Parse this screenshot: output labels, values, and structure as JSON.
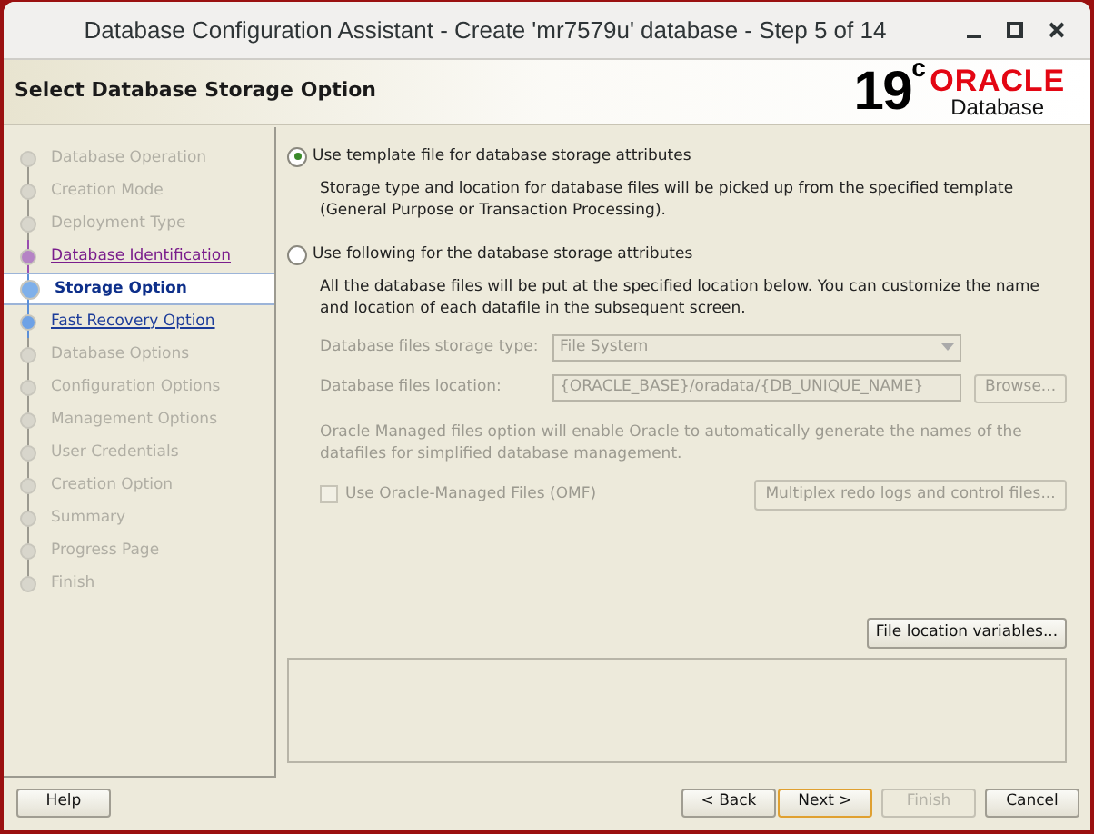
{
  "window": {
    "title": "Database Configuration Assistant - Create 'mr7579u' database  - Step 5 of 14"
  },
  "header": {
    "title": "Select Database Storage Option",
    "logo_version": "19",
    "logo_sup": "c",
    "logo_brand": "ORACLE",
    "logo_product": "Database"
  },
  "steps": [
    {
      "label": "Database Operation",
      "kind": "inactive",
      "selected": false
    },
    {
      "label": "Creation Mode",
      "kind": "inactive",
      "selected": false
    },
    {
      "label": "Deployment Type",
      "kind": "inactive",
      "selected": false
    },
    {
      "label": "Database Identification",
      "kind": "visited",
      "selected": false
    },
    {
      "label": "Storage Option",
      "kind": "current",
      "selected": true
    },
    {
      "label": "Fast Recovery Option",
      "kind": "link",
      "selected": false
    },
    {
      "label": "Database Options",
      "kind": "inactive",
      "selected": false
    },
    {
      "label": "Configuration Options",
      "kind": "inactive",
      "selected": false
    },
    {
      "label": "Management Options",
      "kind": "inactive",
      "selected": false
    },
    {
      "label": "User Credentials",
      "kind": "inactive",
      "selected": false
    },
    {
      "label": "Creation Option",
      "kind": "inactive",
      "selected": false
    },
    {
      "label": "Summary",
      "kind": "inactive",
      "selected": false
    },
    {
      "label": "Progress Page",
      "kind": "inactive",
      "selected": false
    },
    {
      "label": "Finish",
      "kind": "inactive",
      "selected": false
    }
  ],
  "options": [
    {
      "label": "Use template file for database storage attributes",
      "description": "Storage type and location for database files will be picked up from the specified template (General Purpose or Transaction Processing).",
      "selected": true
    },
    {
      "label": "Use following for the database storage attributes",
      "description": "All the database files will be put at the specified location below. You can customize the name and location of each datafile in the subsequent screen.",
      "selected": false
    }
  ],
  "storage_type": {
    "label": "Database files storage type:",
    "value": "File System",
    "disabled": true
  },
  "location": {
    "label": "Database files location:",
    "value": "{ORACLE_BASE}/oradata/{DB_UNIQUE_NAME}",
    "browse": "Browse...",
    "disabled": true
  },
  "omf_note": "Oracle Managed files option will enable Oracle to automatically generate the names of the datafiles for simplified database management.",
  "omf": {
    "label": "Use Oracle-Managed Files (OMF)",
    "checked": false,
    "disabled": true
  },
  "multiplex_button": {
    "label": "Multiplex redo logs and control files...",
    "disabled": true
  },
  "file_location_button": {
    "label": "File location variables...",
    "disabled": false
  },
  "buttons": [
    {
      "label": "Help",
      "kind": "help",
      "disabled": false,
      "default": false
    },
    {
      "label": "< Back",
      "kind": "nav",
      "disabled": false,
      "default": false
    },
    {
      "label": "Next >",
      "kind": "nav",
      "disabled": false,
      "default": true
    },
    {
      "label": "Finish",
      "kind": "nav",
      "disabled": true,
      "default": false
    },
    {
      "label": "Cancel",
      "kind": "cancel",
      "disabled": false,
      "default": false
    }
  ]
}
